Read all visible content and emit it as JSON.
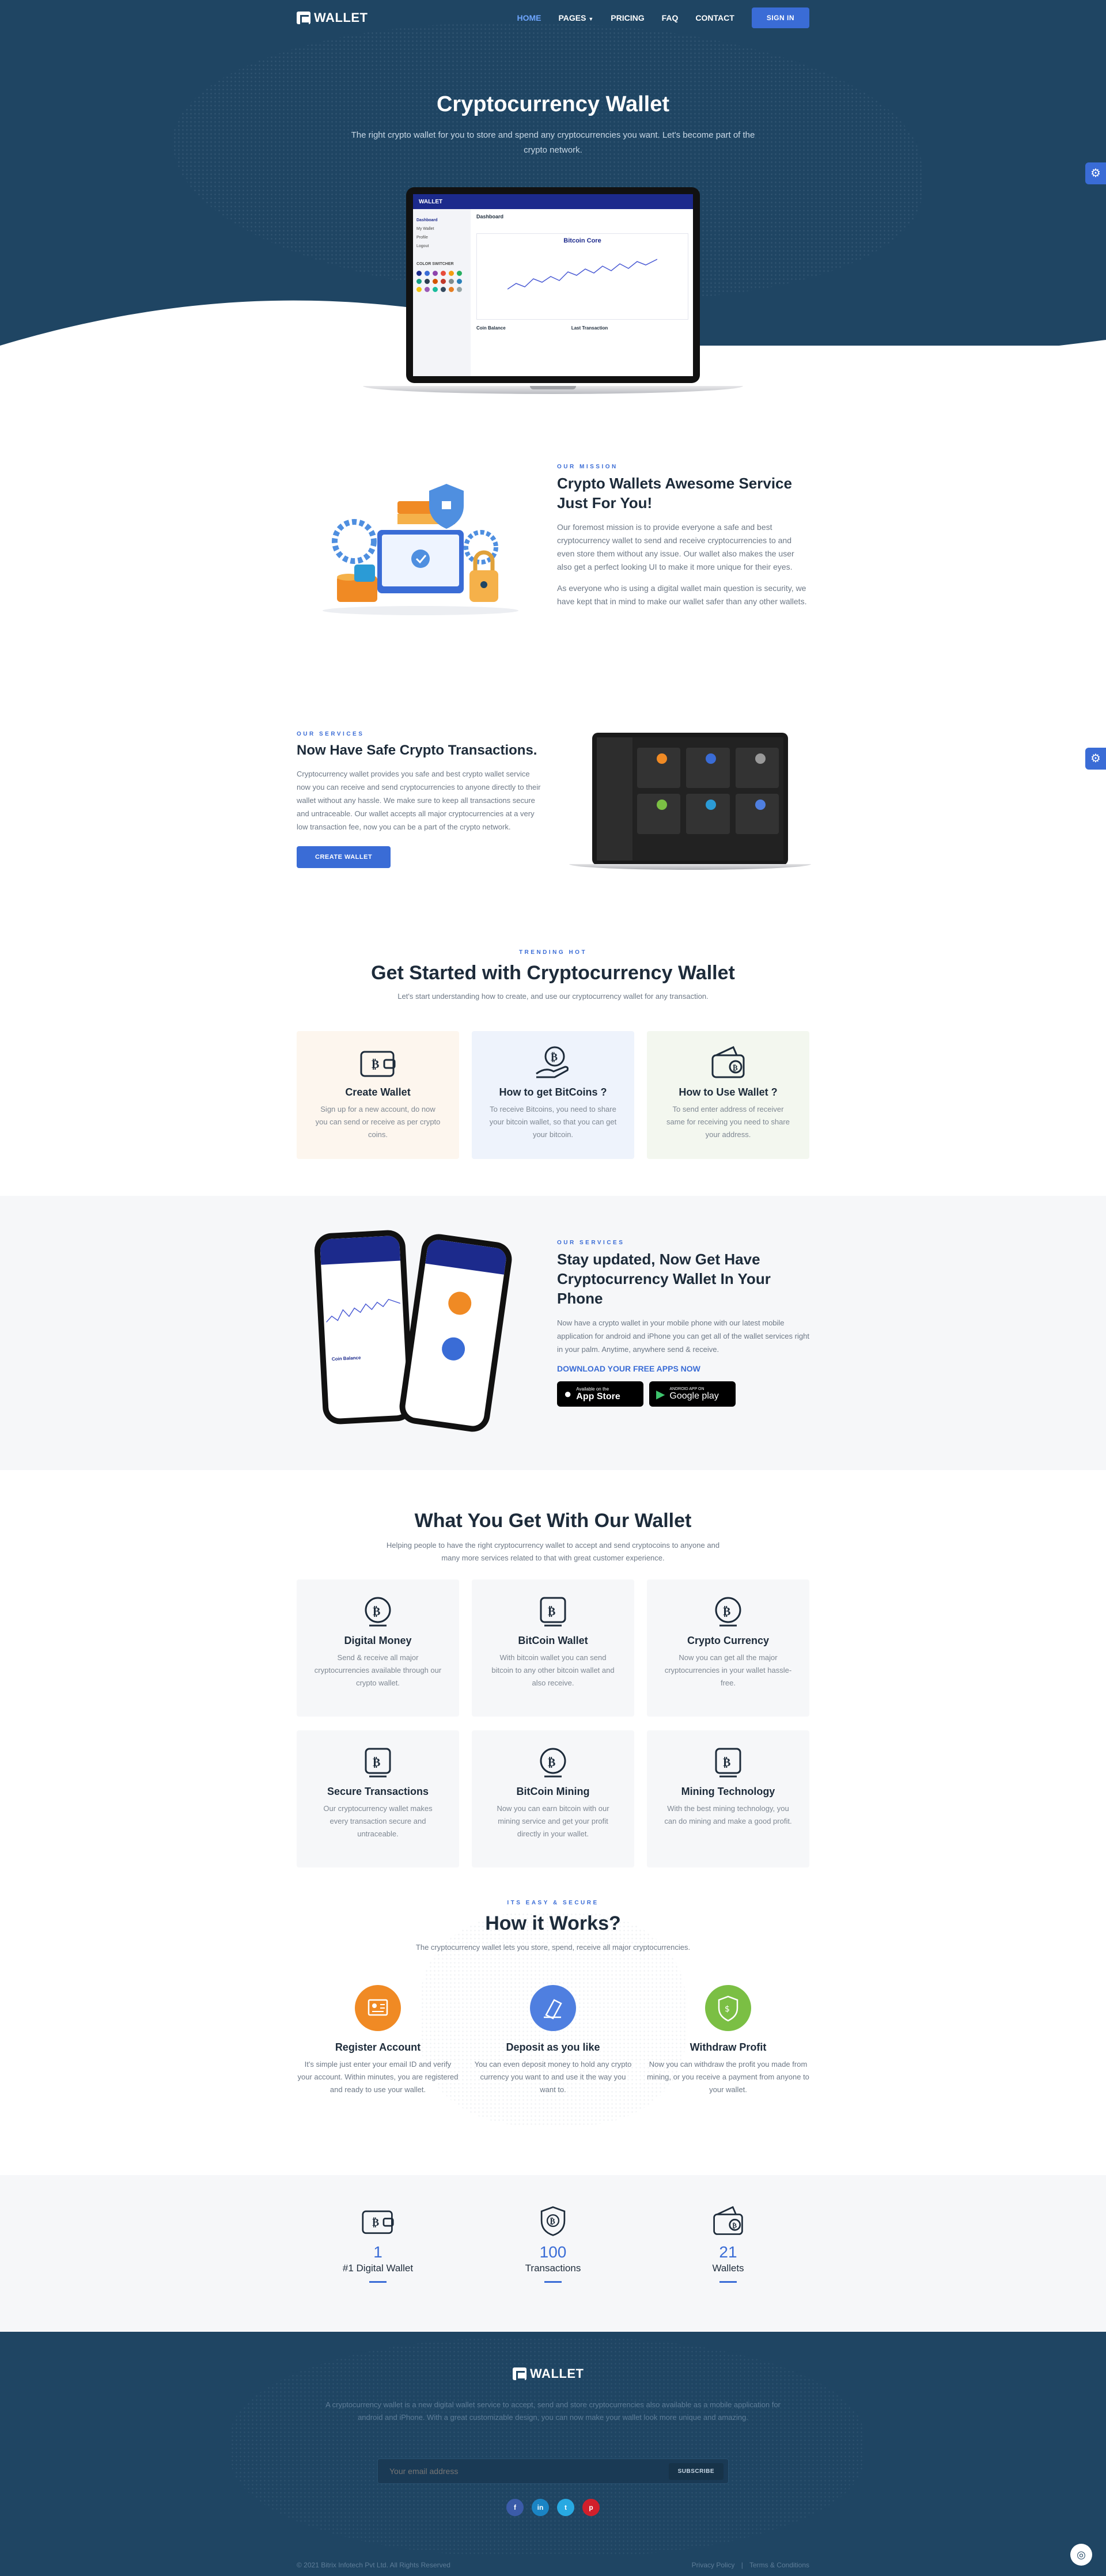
{
  "nav": {
    "logo": "WALLET",
    "items": [
      "HOME",
      "PAGES",
      "PRICING",
      "FAQ",
      "CONTACT"
    ],
    "signin": "SIGN IN"
  },
  "hero": {
    "title": "Cryptocurrency Wallet",
    "subtitle": "The right crypto wallet for you to store and spend any cryptocurrencies you want. Let's become part of the crypto network.",
    "dashboard": {
      "brand": "WALLET",
      "menu": [
        "Dashboard",
        "My Wallet",
        "Profile",
        "Logout"
      ],
      "heading": "Dashboard",
      "chart_title": "Bitcoin Core",
      "theme_label": "COLOR SWITCHER",
      "card1": "Coin Balance",
      "card2": "Last Transaction"
    }
  },
  "mission": {
    "eyebrow": "OUR MISSION",
    "title": "Crypto Wallets Awesome Service Just For You!",
    "p1": "Our foremost mission is to provide everyone a safe and best cryptocurrency wallet to send and receive cryptocurrencies to and even store them without any issue. Our wallet also makes the user also get a perfect looking UI to make it more unique for their eyes.",
    "p2": "As everyone who is using a digital wallet main question is security, we have kept that in mind to make our wallet safer than any other wallets."
  },
  "services": {
    "eyebrow": "OUR SERVICES",
    "title": "Now Have Safe Crypto Transactions.",
    "text": "Cryptocurrency wallet provides you safe and best crypto wallet service now you can receive and send cryptocurrencies to anyone directly to their wallet without any hassle. We make sure to keep all transactions secure and untraceable. Our wallet accepts all major cryptocurrencies at a very low transaction fee, now you can be a part of the crypto network.",
    "button": "CREATE WALLET"
  },
  "started": {
    "eyebrow": "TRENDING HOT",
    "title": "Get Started with Cryptocurrency Wallet",
    "subtitle": "Let's start understanding how to create, and use our cryptocurrency wallet for any transaction.",
    "cards": [
      {
        "icon": "wallet-bitcoin-icon",
        "title": "Create Wallet",
        "text": "Sign up for a new account, do now you can send or receive as per crypto coins.",
        "bg": "#fdf6ee"
      },
      {
        "icon": "hand-bitcoin-icon",
        "title": "How to get BitCoins ?",
        "text": "To receive Bitcoins, you need to share your bitcoin wallet, so that you can get your bitcoin.",
        "bg": "#eef3fc"
      },
      {
        "icon": "wallet-icon",
        "title": "How to Use Wallet ?",
        "text": "To send enter address of receiver same for receiving you need to share your address.",
        "bg": "#f3f7ef"
      }
    ]
  },
  "app": {
    "eyebrow": "OUR SERVICES",
    "title": "Stay updated, Now Get Have Cryptocurrency Wallet In Your Phone",
    "text": "Now have a crypto wallet in your mobile phone with our latest mobile application for android and iPhone you can get all of the wallet services right in your palm. Anytime, anywhere send & receive.",
    "download": "DOWNLOAD YOUR FREE APPS NOW",
    "appstore_small": "Available on the",
    "appstore": "App Store",
    "gplay_small": "ANDROID APP ON",
    "gplay": "Google play"
  },
  "features": {
    "title": "What You Get With Our Wallet",
    "subtitle": "Helping people to have the right cryptocurrency wallet to accept and send cryptocoins to anyone and many more services related to that with great customer experience.",
    "items": [
      {
        "icon": "monitor-bitcoin-icon",
        "title": "Digital Money",
        "text": "Send & receive all major cryptocurrencies available through our crypto wallet."
      },
      {
        "icon": "bitcoin-wallet-icon",
        "title": "BitCoin Wallet",
        "text": "With bitcoin wallet you can send bitcoin to any other bitcoin wallet and also receive."
      },
      {
        "icon": "crypto-network-icon",
        "title": "Crypto Currency",
        "text": "Now you can get all the major cryptocurrencies in your wallet hassle-free."
      },
      {
        "icon": "shield-bitcoin-icon",
        "title": "Secure Transactions",
        "text": "Our cryptocurrency wallet makes every transaction secure and untraceable."
      },
      {
        "icon": "pickaxe-bitcoin-icon",
        "title": "BitCoin Mining",
        "text": "Now you can earn bitcoin with our mining service and get your profit directly in your wallet."
      },
      {
        "icon": "head-bitcoin-icon",
        "title": "Mining Technology",
        "text": "With the best mining technology, you can do mining and make a good profit."
      }
    ]
  },
  "how": {
    "eyebrow": "ITS EASY & SECURE",
    "title": "How it Works?",
    "subtitle": "The cryptocurrency wallet lets you store, spend, receive all major cryptocurrencies.",
    "steps": [
      {
        "icon": "register-icon",
        "color": "#f08a24",
        "title": "Register Account",
        "text": "It's simple just enter your email ID and verify your account. Within minutes, you are registered and ready to use your wallet."
      },
      {
        "icon": "deposit-icon",
        "color": "#4f7fe0",
        "title": "Deposit as you like",
        "text": "You can even deposit money to hold any crypto currency you want to and use it the way you want to."
      },
      {
        "icon": "withdraw-icon",
        "color": "#7bbf44",
        "title": "Withdraw Profit",
        "text": "Now you can withdraw the profit you made from mining, or you receive a payment from anyone to your wallet."
      }
    ]
  },
  "stats": [
    {
      "icon": "wallet-bitcoin-icon",
      "num": "1",
      "label": "#1 Digital Wallet"
    },
    {
      "icon": "shield-bitcoin-icon",
      "num": "100",
      "label": "Transactions"
    },
    {
      "icon": "wallet-icon",
      "num": "21",
      "label": "Wallets"
    }
  ],
  "footer": {
    "logo": "WALLET",
    "text": "A cryptocurrency wallet is a new digital wallet service to accept, send and store cryptocurrencies also available as a mobile application for android and iPhone. With a great customizable design, you can now make your wallet look more unique and amazing.",
    "placeholder": "Your email address",
    "subscribe": "SUBSCRIBE",
    "social": [
      {
        "icon": "facebook-icon",
        "glyph": "f",
        "color": "#3b5ba8"
      },
      {
        "icon": "linkedin-icon",
        "glyph": "in",
        "color": "#1a84c4"
      },
      {
        "icon": "twitter-icon",
        "glyph": "t",
        "color": "#28a9e2"
      },
      {
        "icon": "pinterest-icon",
        "glyph": "p",
        "color": "#d11f2b"
      }
    ],
    "copyright": "© 2021 Bitrix Infotech Pvt Ltd. All Rights Reserved",
    "privacy": "Privacy Policy",
    "terms": "Terms & Conditions"
  }
}
